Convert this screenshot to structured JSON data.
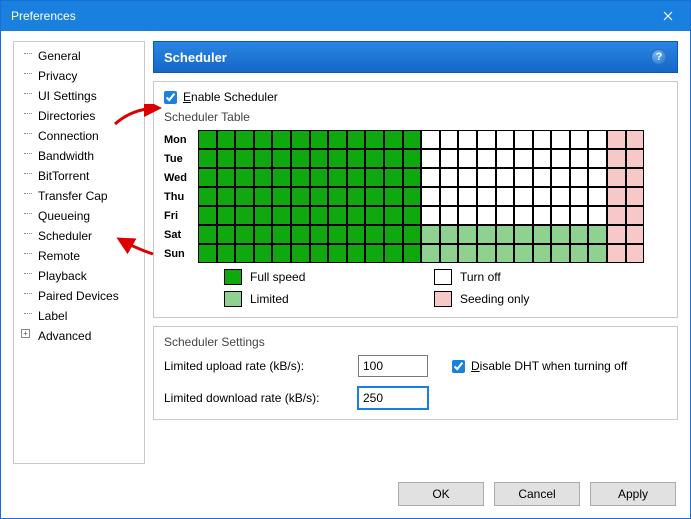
{
  "window": {
    "title": "Preferences"
  },
  "sidebar": {
    "items": [
      {
        "label": "General"
      },
      {
        "label": "Privacy"
      },
      {
        "label": "UI Settings"
      },
      {
        "label": "Directories"
      },
      {
        "label": "Connection"
      },
      {
        "label": "Bandwidth"
      },
      {
        "label": "BitTorrent"
      },
      {
        "label": "Transfer Cap"
      },
      {
        "label": "Queueing"
      },
      {
        "label": "Scheduler"
      },
      {
        "label": "Remote"
      },
      {
        "label": "Playback"
      },
      {
        "label": "Paired Devices"
      },
      {
        "label": "Label"
      },
      {
        "label": "Advanced",
        "expandable": true
      }
    ]
  },
  "header": {
    "title": "Scheduler"
  },
  "scheduler": {
    "enable_label": "Enable Scheduler",
    "enable_checked": true,
    "table_title": "Scheduler Table",
    "days": [
      "Mon",
      "Tue",
      "Wed",
      "Thu",
      "Fri",
      "Sat",
      "Sun"
    ],
    "rows": [
      [
        "full",
        "full",
        "full",
        "full",
        "full",
        "full",
        "full",
        "full",
        "full",
        "full",
        "full",
        "full",
        "off",
        "off",
        "off",
        "off",
        "off",
        "off",
        "off",
        "off",
        "off",
        "off",
        "seed",
        "seed"
      ],
      [
        "full",
        "full",
        "full",
        "full",
        "full",
        "full",
        "full",
        "full",
        "full",
        "full",
        "full",
        "full",
        "off",
        "off",
        "off",
        "off",
        "off",
        "off",
        "off",
        "off",
        "off",
        "off",
        "seed",
        "seed"
      ],
      [
        "full",
        "full",
        "full",
        "full",
        "full",
        "full",
        "full",
        "full",
        "full",
        "full",
        "full",
        "full",
        "off",
        "off",
        "off",
        "off",
        "off",
        "off",
        "off",
        "off",
        "off",
        "off",
        "seed",
        "seed"
      ],
      [
        "full",
        "full",
        "full",
        "full",
        "full",
        "full",
        "full",
        "full",
        "full",
        "full",
        "full",
        "full",
        "off",
        "off",
        "off",
        "off",
        "off",
        "off",
        "off",
        "off",
        "off",
        "off",
        "seed",
        "seed"
      ],
      [
        "full",
        "full",
        "full",
        "full",
        "full",
        "full",
        "full",
        "full",
        "full",
        "full",
        "full",
        "full",
        "off",
        "off",
        "off",
        "off",
        "off",
        "off",
        "off",
        "off",
        "off",
        "off",
        "seed",
        "seed"
      ],
      [
        "full",
        "full",
        "full",
        "full",
        "full",
        "full",
        "full",
        "full",
        "full",
        "full",
        "full",
        "full",
        "lim",
        "lim",
        "lim",
        "lim",
        "lim",
        "lim",
        "lim",
        "lim",
        "lim",
        "lim",
        "seed",
        "seed"
      ],
      [
        "full",
        "full",
        "full",
        "full",
        "full",
        "full",
        "full",
        "full",
        "full",
        "full",
        "full",
        "full",
        "lim",
        "lim",
        "lim",
        "lim",
        "lim",
        "lim",
        "lim",
        "lim",
        "lim",
        "lim",
        "seed",
        "seed"
      ]
    ],
    "legend": {
      "full": "Full speed",
      "off": "Turn off",
      "lim": "Limited",
      "seed": "Seeding only"
    }
  },
  "settings": {
    "title": "Scheduler Settings",
    "upload_label": "Limited upload rate (kB/s):",
    "upload_value": "100",
    "download_label": "Limited download rate (kB/s):",
    "download_value": "250",
    "dht_label": "Disable DHT when turning off",
    "dht_checked": true
  },
  "footer": {
    "ok": "OK",
    "cancel": "Cancel",
    "apply": "Apply"
  },
  "colors": {
    "full": "#0fa80f",
    "off": "#ffffff",
    "lim": "#8fd28f",
    "seed": "#f6c8c8"
  }
}
